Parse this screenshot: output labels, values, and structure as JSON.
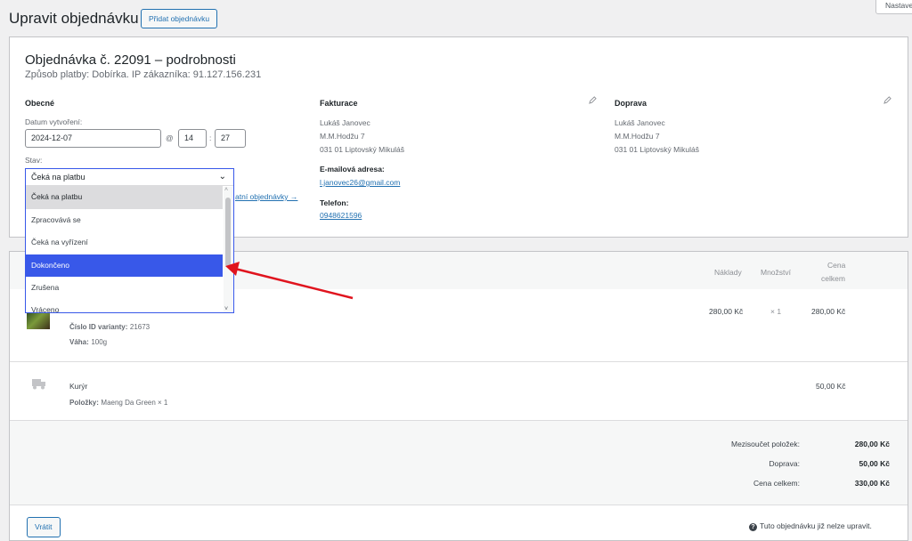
{
  "header": {
    "title": "Upravit objednávku",
    "add_order_label": "Přidat objednávku",
    "screen_options_label": "Nastave"
  },
  "order": {
    "title": "Objednávka č. 22091 – podrobnosti",
    "subtitle": "Způsob platby: Dobírka. IP zákazníka: 91.127.156.231"
  },
  "general": {
    "heading": "Obecné",
    "date_label": "Datum vytvoření:",
    "date_value": "2024-12-07",
    "at_symbol": "@",
    "hour": "14",
    "minute": "27",
    "time_sep": ":",
    "status_label": "Stav:",
    "status_selected": "Čeká na platbu",
    "status_options": [
      "Čeká na platbu",
      "Zpracovává se",
      "Čeká na vyřízení",
      "Dokončeno",
      "Zrušena",
      "Vráceno"
    ],
    "hover_index": 0,
    "highlight_index": 3,
    "behind_link": "atní objednávky →"
  },
  "billing": {
    "heading": "Fakturace",
    "name": "Lukáš Janovec",
    "street": "M.M.Hodžu 7",
    "city": "031 01 Liptovský Mikuláš",
    "email_label": "E-mailová adresa:",
    "email": "l.janovec26@gmail.com",
    "phone_label": "Telefon:",
    "phone": "0948621596"
  },
  "shipping": {
    "heading": "Doprava",
    "name": "Lukáš Janovec",
    "street": "M.M.Hodžu 7",
    "city": "031 01 Liptovský Mikuláš"
  },
  "items_table": {
    "col_cost": "Náklady",
    "col_qty": "Množství",
    "col_total_1": "Cena",
    "col_total_2": "celkem",
    "item": {
      "variant_key": "Číslo ID varianty:",
      "variant_value": "21673",
      "weight_key": "Váha:",
      "weight_value": "100g",
      "cost": "280,00 Kč",
      "qty": "× 1",
      "total": "280,00 Kč"
    },
    "shipping_row": {
      "name": "Kurýr",
      "items_key": "Položky:",
      "items_value": "Maeng Da Green × 1",
      "total": "50,00 Kč"
    }
  },
  "totals": {
    "subtotal_label": "Mezisoučet položek:",
    "subtotal_value": "280,00 Kč",
    "shipping_label": "Doprava:",
    "shipping_value": "50,00 Kč",
    "total_label": "Cena celkem:",
    "total_value": "330,00 Kč"
  },
  "footer": {
    "refund_label": "Vrátit",
    "note": "Tuto objednávku již nelze upravit.",
    "note_icon": "?"
  },
  "colors": {
    "accent": "#2271b1",
    "dropdown_highlight": "#3858e9",
    "arrow": "#e0141e"
  },
  "icons": [
    "pencil-icon",
    "truck-icon",
    "help-icon",
    "chevron-down-icon"
  ]
}
